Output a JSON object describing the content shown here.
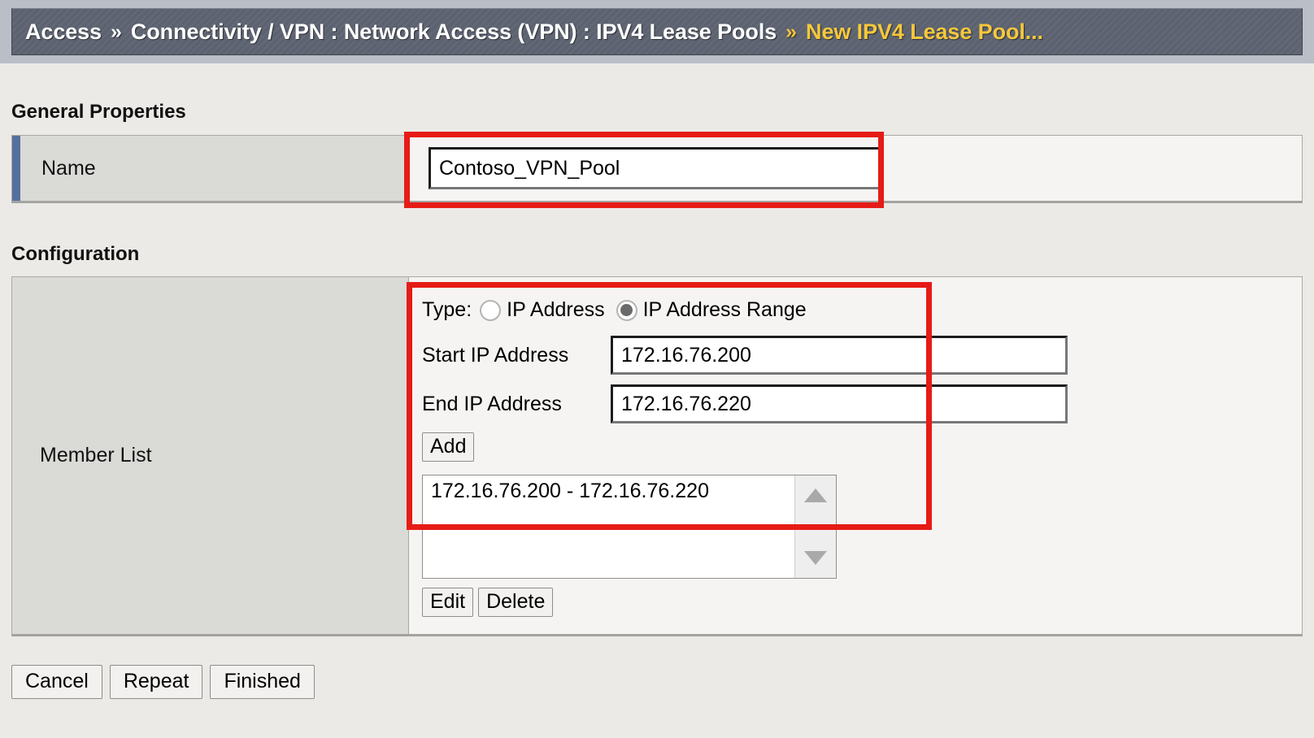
{
  "breadcrumb": {
    "root": "Access",
    "sep1": "»",
    "path": "Connectivity / VPN : Network Access (VPN) : IPV4 Lease Pools",
    "sep2": "»",
    "current": "New IPV4 Lease Pool...",
    "colors": {
      "bar_background": "#5c6270",
      "text": "#ffffff",
      "current_text": "#f5c83c"
    }
  },
  "general_properties": {
    "title": "General Properties",
    "name": {
      "label": "Name",
      "value": "Contoso_VPN_Pool",
      "placeholder": "",
      "required": true
    }
  },
  "configuration": {
    "title": "Configuration",
    "member_list": {
      "label": "Member List",
      "type": {
        "label": "Type:",
        "options": [
          {
            "label": "IP Address",
            "selected": false
          },
          {
            "label": "IP Address Range",
            "selected": true
          }
        ]
      },
      "start_ip": {
        "label": "Start IP Address",
        "value": "172.16.76.200",
        "placeholder": ""
      },
      "end_ip": {
        "label": "End IP Address",
        "value": "172.16.76.220",
        "placeholder": ""
      },
      "add_label": "Add",
      "entries": [
        "172.16.76.200 - 172.16.76.220"
      ],
      "edit_label": "Edit",
      "delete_label": "Delete",
      "scroll_up_icon": "triangle-up-icon",
      "scroll_down_icon": "triangle-down-icon"
    }
  },
  "footer": {
    "cancel_label": "Cancel",
    "repeat_label": "Repeat",
    "finished_label": "Finished"
  },
  "annotations": {
    "color": "#e61b16",
    "boxes": [
      "name-field-highlight",
      "member-list-highlight"
    ]
  }
}
